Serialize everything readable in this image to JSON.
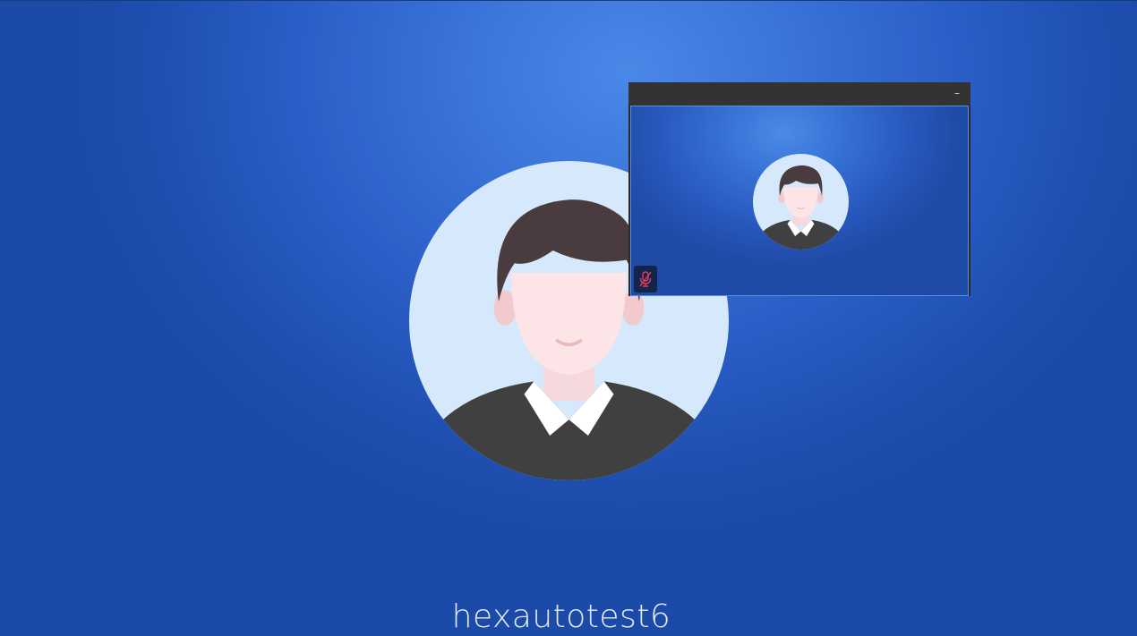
{
  "participant": {
    "name": "hexautotest6",
    "avatar_icon": "default-user-avatar-icon"
  },
  "pip_window": {
    "minimize_label": "–",
    "avatar_icon": "default-user-avatar-icon",
    "mic_status_icon": "mic-muted-icon",
    "mic_muted": true
  },
  "colors": {
    "background": "#2a5ec6",
    "muted_mic": "#e0405a",
    "avatar_circle": "#d6e8fb",
    "hair": "#4a3b3f",
    "shirt": "#404040"
  }
}
